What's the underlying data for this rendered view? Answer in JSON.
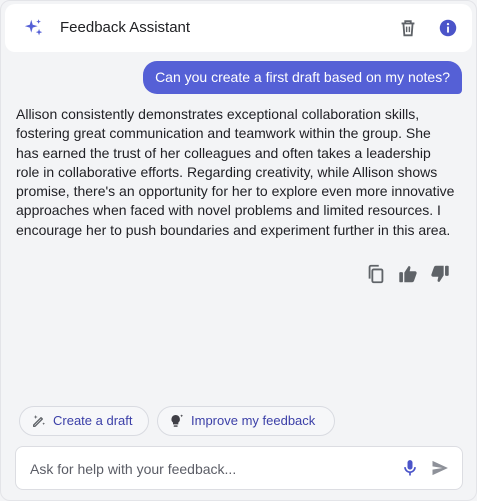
{
  "header": {
    "title": "Feedback Assistant",
    "logo_icon": "sparkle-icon",
    "actions": [
      "trash-icon",
      "info-icon"
    ]
  },
  "conversation": {
    "user_message": "Can you create a first draft based on my notes?",
    "assistant_reply": "Allison consistently demonstrates exceptional collaboration skills, fostering great communication and teamwork within the group. She has earned the trust of her colleagues and often takes a leadership role in collaborative efforts. Regarding creativity, while Allison shows promise, there's an opportunity for her to explore even more innovative approaches when faced with novel problems and limited resources. I encourage her to push boundaries and experiment further in this area.",
    "reply_actions": [
      "copy-icon",
      "thumbs-up-icon",
      "thumbs-down-icon"
    ]
  },
  "suggestions": [
    {
      "label": "Create a draft",
      "icon": "magic-pen-icon"
    },
    {
      "label": "Improve my feedback",
      "icon": "lightbulb-sparkle-icon"
    }
  ],
  "composer": {
    "placeholder": "Ask for help with your feedback...",
    "value": "",
    "icons": [
      "microphone-icon",
      "send-icon"
    ]
  },
  "colors": {
    "accent": "#5560d6",
    "chip_text": "#3c40a8",
    "background": "#f3f4f6",
    "icon_gray": "#5f6368"
  }
}
